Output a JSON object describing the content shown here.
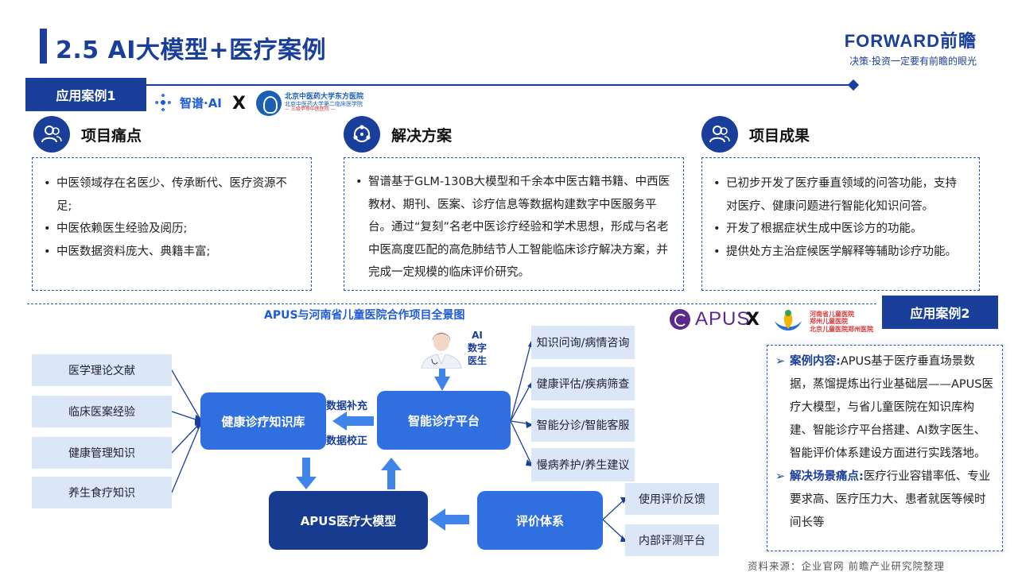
{
  "header": {
    "title": "2.5 AI大模型+医疗案例",
    "brand_name": "FORWARD前瞻",
    "brand_tag": "决策·投资一定要有前瞻的眼光"
  },
  "case1": {
    "label": "应用案例1",
    "partner_a": "智谱·AI",
    "x": "X",
    "partner_b_line1": "北京中医药大学东方医院",
    "partner_b_line2": "北京中医药大学第二临床医学院",
    "partner_b_line3": "— 三级甲等中医医院 —",
    "pain": {
      "title": "项目痛点",
      "items": [
        "中医领域存在名医少、传承断代、医疗资源不足;",
        "中医依赖医生经验及阅历;",
        "中医数据资料庞大、典籍丰富;"
      ]
    },
    "solution": {
      "title": "解决方案",
      "items": [
        "智谱基于GLM-130B大模型和千余本中医古籍书籍、中西医教材、期刊、医案、诊疗信息等数据构建数字中医服务平台。通过“复刻”名老中医诊疗经验和学术思想，形成与名老中医高度匹配的高危肺结节人工智能临床诊疗解决方案，并完成一定规模的临床评价研究。"
      ]
    },
    "result": {
      "title": "项目成果",
      "items": [
        "已初步开发了医疗垂直领域的问答功能，支持对医疗、健康问题进行智能化知识问答。",
        "开发了根据症状生成中医诊方的功能。",
        "提供处方主治症候医学解释等辅助诊疗功能。"
      ]
    }
  },
  "diagram": {
    "title": "APUS与河南省儿童医院合作项目全景图",
    "sources": [
      "医学理论文献",
      "临床医案经验",
      "健康管理知识",
      "养生食疗知识"
    ],
    "kb": "健康诊疗知识库",
    "platform": "智能诊疗平台",
    "model": "APUS医疗大模型",
    "eval": "评价体系",
    "supplement": "数据补充",
    "correction": "数据校正",
    "ai_doctor": [
      "AI",
      "数字",
      "医生"
    ],
    "outputs": [
      "知识问询/病情咨询",
      "健康评估/疾病筛查",
      "智能分诊/智能客服",
      "慢病养护/养生建议"
    ],
    "eval_outputs": [
      "使用评价反馈",
      "内部评测平台"
    ]
  },
  "case2": {
    "label": "应用案例2",
    "apus": "APUS",
    "x": "X",
    "hospital_lines": [
      "河南省儿童医院",
      "郑州儿童医院",
      "北京儿童医院郑州医院"
    ],
    "content_key": "案例内容:",
    "content_text": "APUS基于医疗垂直场景数据，蒸馏提炼出行业基础层——APUS医疗大模型，与省儿童医院在知识库构建、智能诊疗平台搭建、AI数字医生、智能评价体系建设方面进行实践落地。",
    "pain_key": "解决场景痛点:",
    "pain_text": "医疗行业容错率低、专业要求高、医疗压力大、患者就医等候时间长等"
  },
  "source": "资料来源：企业官网 前瞻产业研究院整理",
  "colors": {
    "primary": "#1a3f9a",
    "accent": "#2f6fe0",
    "light": "#dbe6f7",
    "apus": "#5b2a8a"
  }
}
